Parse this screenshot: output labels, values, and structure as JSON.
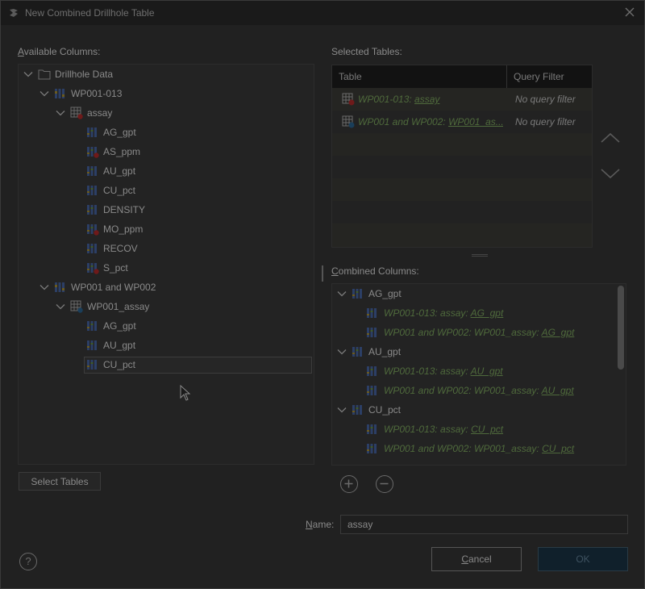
{
  "window": {
    "title": "New Combined Drillhole Table"
  },
  "available_columns": {
    "label": "Available Columns:",
    "tree": [
      {
        "label": "Drillhole Data"
      },
      {
        "label": "WP001-013"
      },
      {
        "label": "assay"
      },
      {
        "label": "AG_gpt"
      },
      {
        "label": "AS_ppm"
      },
      {
        "label": "AU_gpt"
      },
      {
        "label": "CU_pct"
      },
      {
        "label": "DENSITY"
      },
      {
        "label": "MO_ppm"
      },
      {
        "label": "RECOV"
      },
      {
        "label": "S_pct"
      },
      {
        "label": "WP001 and WP002"
      },
      {
        "label": "WP001_assay"
      },
      {
        "label": "AG_gpt"
      },
      {
        "label": "AU_gpt"
      },
      {
        "label": "CU_pct"
      }
    ]
  },
  "select_tables_button": "Select Tables",
  "selected_tables": {
    "label": "Selected Tables:",
    "headers": {
      "table": "Table",
      "query_filter": "Query Filter"
    },
    "rows": [
      {
        "prefix": "WP001-013: ",
        "link": "assay",
        "filter": "No query filter"
      },
      {
        "prefix": "WP001 and WP002: ",
        "link": "WP001_as...",
        "filter": "No query filter"
      }
    ]
  },
  "combined_columns": {
    "label": "Combined Columns:",
    "groups": [
      {
        "label": "AG_gpt",
        "children": [
          {
            "prefix": "WP001-013: assay: ",
            "link": "AG_gpt"
          },
          {
            "prefix": "WP001 and WP002: WP001_assay: ",
            "link": "AG_gpt"
          }
        ]
      },
      {
        "label": "AU_gpt",
        "children": [
          {
            "prefix": "WP001-013: assay: ",
            "link": "AU_gpt"
          },
          {
            "prefix": "WP001 and WP002: WP001_assay: ",
            "link": "AU_gpt"
          }
        ]
      },
      {
        "label": "CU_pct",
        "children": [
          {
            "prefix": "WP001-013: assay: ",
            "link": "CU_pct"
          },
          {
            "prefix": "WP001 and WP002: WP001_assay: ",
            "link": "CU_pct"
          }
        ]
      }
    ]
  },
  "name_field": {
    "label": "Name:",
    "value": "assay"
  },
  "buttons": {
    "cancel": "Cancel",
    "ok": "OK",
    "help": "?"
  },
  "colors": {
    "background": "#212121",
    "titlebar": "#1a1a1a",
    "link_green": "#4f6a3c",
    "ok_bg": "#10202b"
  }
}
